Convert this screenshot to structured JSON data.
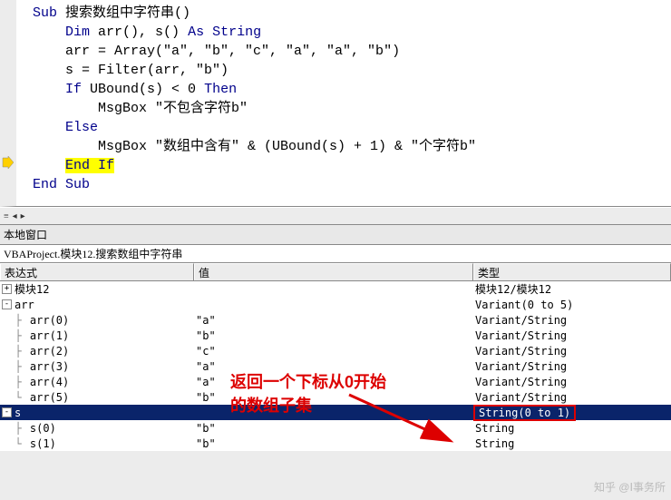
{
  "code": {
    "l1": {
      "a": "Sub",
      "b": " 搜索数组中字符串()"
    },
    "l2": {
      "a": "Dim",
      "b": " arr(), s() ",
      "c": "As String"
    },
    "l3": "    arr = Array(\"a\", \"b\", \"c\", \"a\", \"a\", \"b\")",
    "l4": "    s = Filter(arr, \"b\")",
    "l5": {
      "a": "    ",
      "b": "If",
      "c": " UBound(s) < 0 ",
      "d": "Then"
    },
    "l6": "        MsgBox \"不包含字符b\"",
    "l7": {
      "a": "    ",
      "b": "Else"
    },
    "l8": "        MsgBox \"数组中含有\" & (UBound(s) + 1) & \"个字符b\"",
    "l9": {
      "a": "    ",
      "b": "End If"
    },
    "l10": {
      "a": "End Sub"
    }
  },
  "locals": {
    "title": "本地窗口",
    "project": "VBAProject.模块12.搜索数组中字符串",
    "headers": {
      "expr": "表达式",
      "val": "值",
      "type": "类型"
    },
    "rows": [
      {
        "icon": "+",
        "indent": "",
        "name": "模块12",
        "val": "",
        "type": "模块12/模块12"
      },
      {
        "icon": "-",
        "indent": "",
        "name": "arr",
        "val": "",
        "type": "Variant(0 to 5)"
      },
      {
        "icon": "",
        "indent": "  ├ ",
        "name": "arr(0)",
        "val": "\"a\"",
        "type": "Variant/String"
      },
      {
        "icon": "",
        "indent": "  ├ ",
        "name": "arr(1)",
        "val": "\"b\"",
        "type": "Variant/String"
      },
      {
        "icon": "",
        "indent": "  ├ ",
        "name": "arr(2)",
        "val": "\"c\"",
        "type": "Variant/String"
      },
      {
        "icon": "",
        "indent": "  ├ ",
        "name": "arr(3)",
        "val": "\"a\"",
        "type": "Variant/String"
      },
      {
        "icon": "",
        "indent": "  ├ ",
        "name": "arr(4)",
        "val": "\"a\"",
        "type": "Variant/String"
      },
      {
        "icon": "",
        "indent": "  └ ",
        "name": "arr(5)",
        "val": "\"b\"",
        "type": "Variant/String"
      },
      {
        "icon": "-",
        "indent": "",
        "name": "s",
        "val": "",
        "type": "String(0 to 1)",
        "selected": true,
        "boxed": true
      },
      {
        "icon": "",
        "indent": "  ├ ",
        "name": "s(0)",
        "val": "\"b\"",
        "type": "String"
      },
      {
        "icon": "",
        "indent": "  └ ",
        "name": "s(1)",
        "val": "\"b\"",
        "type": "String"
      }
    ]
  },
  "annotation": {
    "line1": "返回一个下标从0开始",
    "line2": "的数组子集"
  },
  "watermark": "知乎 @Ⅰ事务所"
}
